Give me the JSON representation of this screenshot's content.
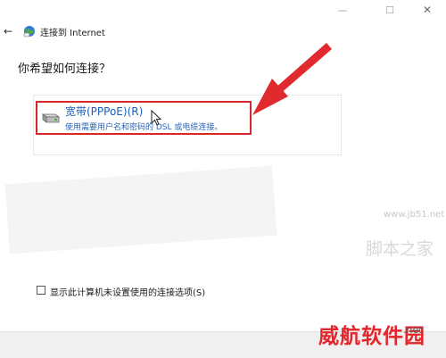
{
  "window": {
    "minimize_glyph": "—",
    "maximize_glyph": "☐",
    "close_glyph": "✕"
  },
  "nav": {
    "back_glyph": "←",
    "title": "连接到 Internet"
  },
  "heading": "你希望如何连接？",
  "option": {
    "title": "宽带(PPPoE)(R)",
    "description": "使用需要用户名和密码的 DSL 或电缆连接。"
  },
  "checkbox": {
    "label": "显示此计算机未设置使用的连接选项(S)",
    "checked": false
  },
  "watermarks": {
    "url": "www.jb51.net",
    "brand": "脚本之家",
    "site": "威航软件园",
    "site_suffix": ".net"
  },
  "colors": {
    "highlight_border": "#d9262a",
    "arrow": "#e02a2e",
    "link_blue": "#1c5fb8"
  },
  "icons": {
    "globe": "network-globe-icon",
    "drive": "broadband-modem-icon",
    "cursor": "mouse-pointer-icon"
  }
}
